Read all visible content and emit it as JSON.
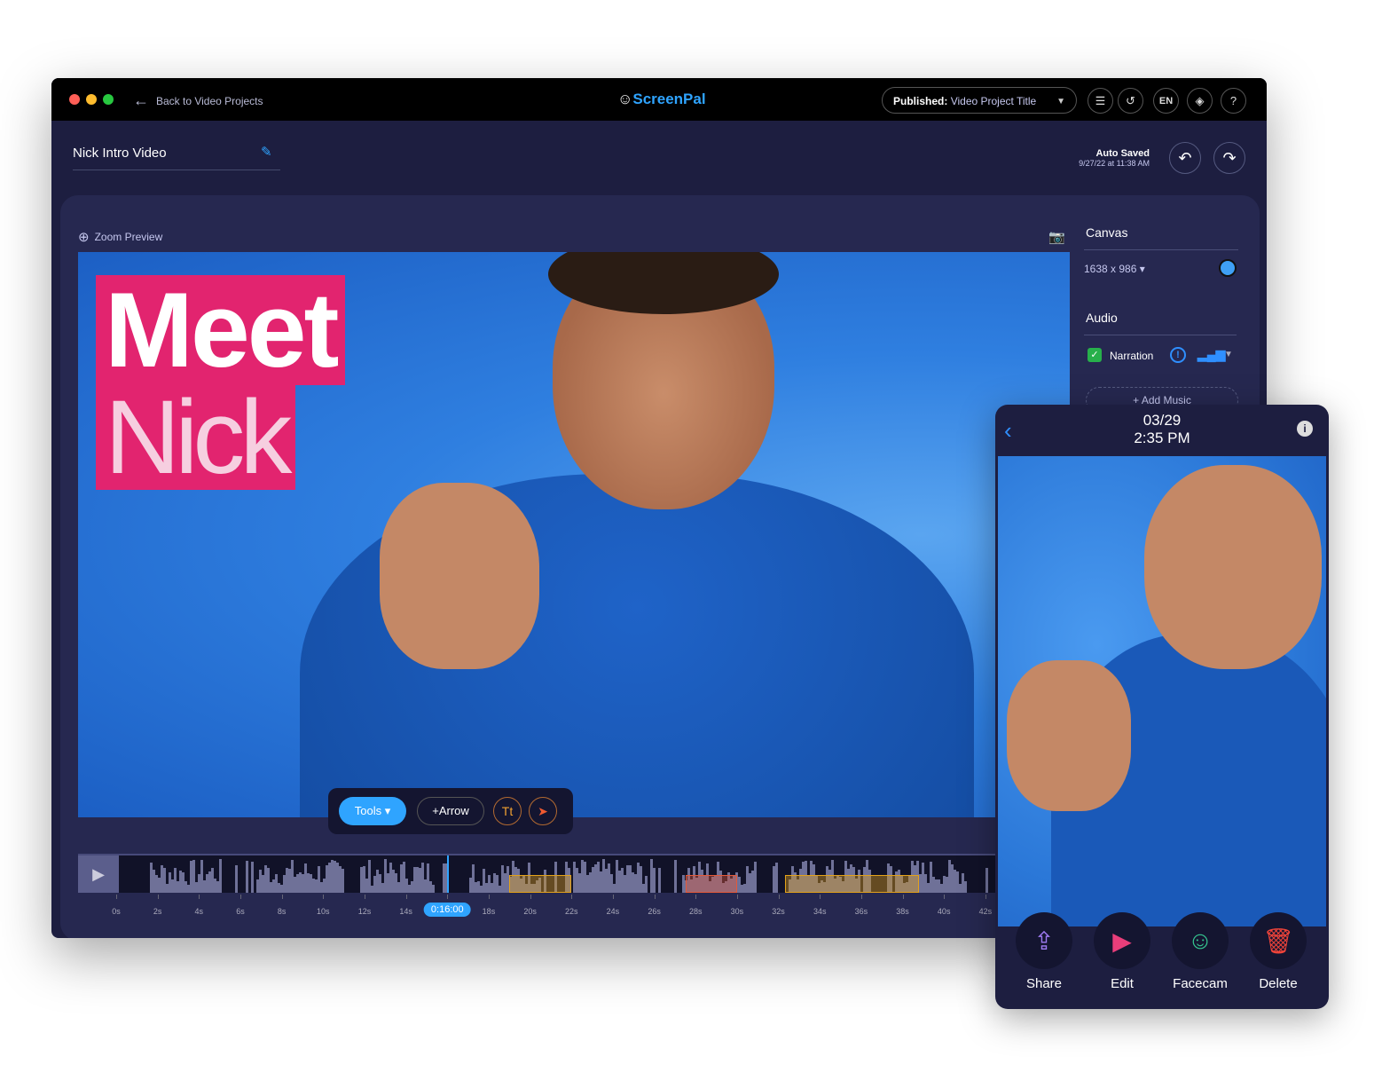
{
  "titlebar": {
    "back_label": "Back to Video Projects",
    "logo_text": "ScreenPal",
    "published_label": "Published:",
    "published_title": "Video Project Title",
    "lang": "EN",
    "help": "?"
  },
  "project": {
    "name": "Nick Intro Video",
    "autosave_label": "Auto Saved",
    "autosave_time": "9/27/22 at 11:38 AM"
  },
  "preview": {
    "zoom_label": "Zoom Preview",
    "overlay_line1": "Meet",
    "overlay_line2": "Nick"
  },
  "sidebar": {
    "canvas_heading": "Canvas",
    "canvas_size": "1638 x 986",
    "canvas_color": "#3fa0f5",
    "audio_heading": "Audio",
    "narration_label": "Narration",
    "narration_checked": true,
    "add_music_label": "Add Music"
  },
  "toolbar": {
    "tools_label": "Tools",
    "arrow_label": "Arrow",
    "text_icon": "Tt"
  },
  "timeline": {
    "playhead": "0:16:00",
    "ticks": [
      "0s",
      "2s",
      "4s",
      "6s",
      "8s",
      "10s",
      "12s",
      "14s",
      "16s",
      "18s",
      "20s",
      "22s",
      "24s",
      "26s",
      "28s",
      "30s",
      "32s",
      "34s",
      "36s",
      "38s",
      "40s",
      "42s"
    ],
    "clips": [
      {
        "start": 19,
        "end": 22,
        "color": "#e3a21a"
      },
      {
        "start": 27.5,
        "end": 30,
        "color": "#e35a3a"
      },
      {
        "start": 32.3,
        "end": 38.8,
        "color": "#e3a21a"
      }
    ]
  },
  "phone": {
    "date": "03/29",
    "time": "2:35 PM",
    "actions": [
      {
        "label": "Share",
        "icon": "share-icon",
        "color": "#a07cf5"
      },
      {
        "label": "Edit",
        "icon": "edit-clapper-icon",
        "color": "#e83e7a"
      },
      {
        "label": "Facecam",
        "icon": "facecam-icon",
        "color": "#35c48f"
      },
      {
        "label": "Delete",
        "icon": "trash-icon",
        "color": "#f0443a"
      }
    ]
  },
  "colors": {
    "accent": "#2fa4ff",
    "brand_pink": "#e2246f",
    "window_bg": "#1d1e40"
  }
}
